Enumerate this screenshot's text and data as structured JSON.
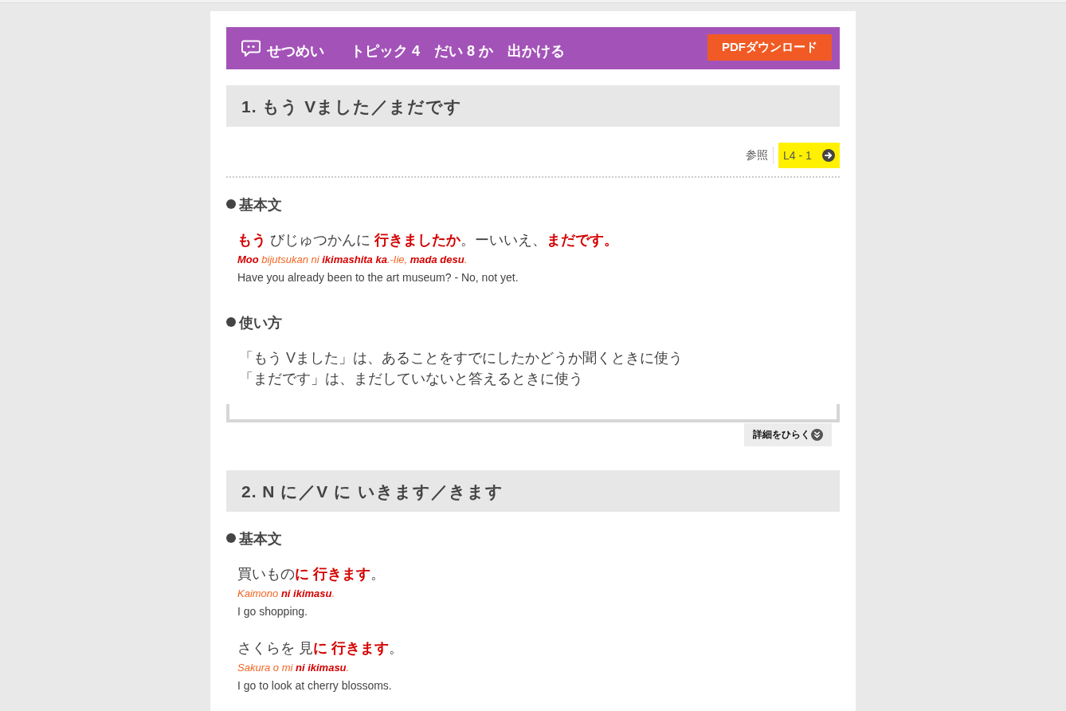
{
  "header": {
    "title": "せつめい",
    "heading_parts": [
      "トピック 4",
      "だい 8 か",
      "出かける"
    ],
    "download_button": "PDFダウンロード"
  },
  "sections": [
    {
      "title": "1. もう Vました／まだです",
      "reference": {
        "label": "参照",
        "link": "L4 - 1"
      },
      "blocks": [
        {
          "kind": "examples",
          "heading": "基本文",
          "examples": [
            {
              "japanese": "**もう** びじゅつかんに **行きましたか**。ーいいえ、**まだです。**",
              "romaji": "**Moo** bijutsukan ni **ikimashita ka**.-Iie, **mada desu**.",
              "english": "Have you already been to the art museum? - No, not yet."
            }
          ]
        },
        {
          "kind": "usage",
          "heading": "使い方",
          "lines": [
            "「もう Vました」は、あることをすでにしたかどうか聞くときに使う",
            "「まだです」は、まだしていないと答えるときに使う"
          ]
        }
      ],
      "details_button": "詳細をひらく"
    },
    {
      "title": "2. N に／V に いきます／きます",
      "blocks": [
        {
          "kind": "examples",
          "heading": "基本文",
          "examples": [
            {
              "japanese": "買いもの**に 行きます**。",
              "romaji": "Kaimono **ni ikimasu**.",
              "english": "I go shopping."
            },
            {
              "japanese": "さくらを 見**に 行きます**。",
              "romaji": "Sakura o mi **ni ikimasu**.",
              "english": "I go to look at cherry blossoms."
            }
          ]
        }
      ]
    }
  ]
}
